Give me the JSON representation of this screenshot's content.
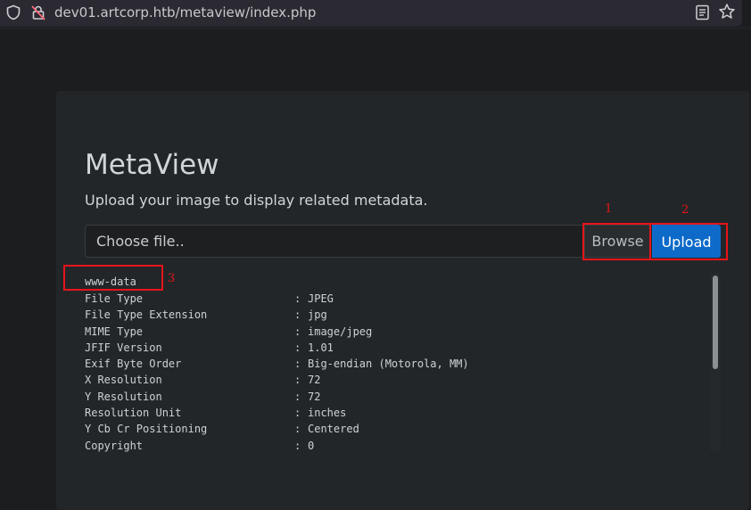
{
  "browser": {
    "url": "dev01.artcorp.htb/metaview/index.php"
  },
  "page": {
    "title": "MetaView",
    "subtitle": "Upload your image to display related metadata."
  },
  "upload_form": {
    "file_placeholder": "Choose file..",
    "browse_label": "Browse",
    "upload_label": "Upload"
  },
  "annotations": {
    "n1": "1",
    "n2": "2",
    "n3": "3",
    "color": "#e8141a"
  },
  "output": {
    "user": "www-data",
    "rows": [
      {
        "key": "File Type",
        "value": "JPEG"
      },
      {
        "key": "File Type Extension",
        "value": "jpg"
      },
      {
        "key": "MIME Type",
        "value": "image/jpeg"
      },
      {
        "key": "JFIF Version",
        "value": "1.01"
      },
      {
        "key": "Exif Byte Order",
        "value": "Big-endian (Motorola, MM)"
      },
      {
        "key": "X Resolution",
        "value": "72"
      },
      {
        "key": "Y Resolution",
        "value": "72"
      },
      {
        "key": "Resolution Unit",
        "value": "inches"
      },
      {
        "key": "Y Cb Cr Positioning",
        "value": "Centered"
      },
      {
        "key": "Copyright",
        "value": "0"
      }
    ],
    "separator": ":"
  },
  "colors": {
    "upload_button": "#0d6ac9",
    "card_background": "#232628"
  }
}
